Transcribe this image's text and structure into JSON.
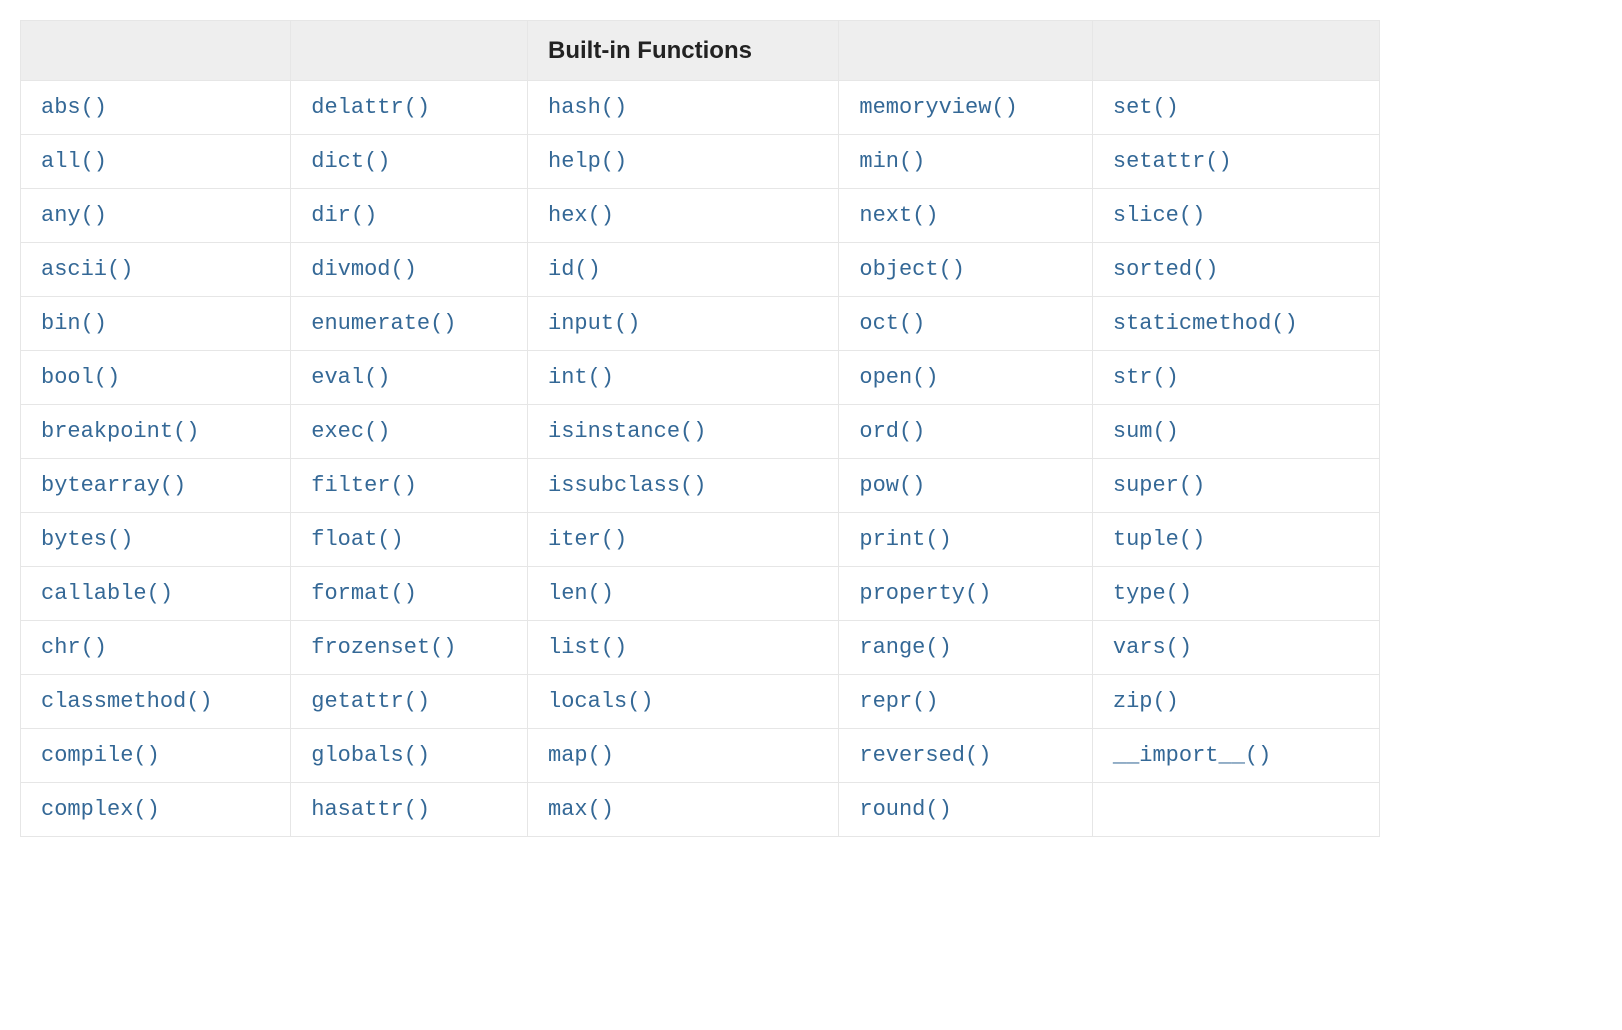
{
  "table": {
    "header": [
      "",
      "",
      "Built-in Functions",
      "",
      ""
    ],
    "columns": [
      [
        "abs()",
        "all()",
        "any()",
        "ascii()",
        "bin()",
        "bool()",
        "breakpoint()",
        "bytearray()",
        "bytes()",
        "callable()",
        "chr()",
        "classmethod()",
        "compile()",
        "complex()"
      ],
      [
        "delattr()",
        "dict()",
        "dir()",
        "divmod()",
        "enumerate()",
        "eval()",
        "exec()",
        "filter()",
        "float()",
        "format()",
        "frozenset()",
        "getattr()",
        "globals()",
        "hasattr()"
      ],
      [
        "hash()",
        "help()",
        "hex()",
        "id()",
        "input()",
        "int()",
        "isinstance()",
        "issubclass()",
        "iter()",
        "len()",
        "list()",
        "locals()",
        "map()",
        "max()"
      ],
      [
        "memoryview()",
        "min()",
        "next()",
        "object()",
        "oct()",
        "open()",
        "ord()",
        "pow()",
        "print()",
        "property()",
        "range()",
        "repr()",
        "reversed()",
        "round()"
      ],
      [
        "set()",
        "setattr()",
        "slice()",
        "sorted()",
        "staticmethod()",
        "str()",
        "sum()",
        "super()",
        "tuple()",
        "type()",
        "vars()",
        "zip()",
        "__import__()",
        ""
      ]
    ]
  }
}
